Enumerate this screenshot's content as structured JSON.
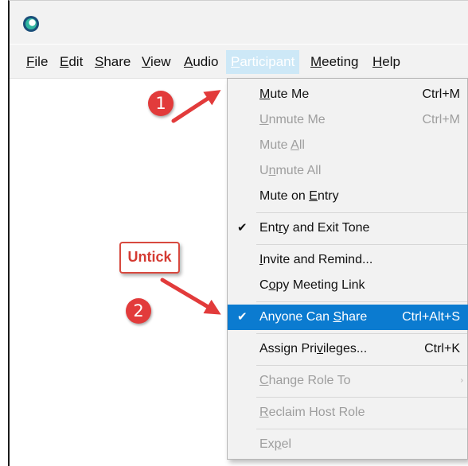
{
  "menubar": {
    "items": [
      {
        "before": "",
        "mnemonic": "F",
        "after": "ile"
      },
      {
        "before": "",
        "mnemonic": "E",
        "after": "dit"
      },
      {
        "before": "",
        "mnemonic": "S",
        "after": "hare"
      },
      {
        "before": "",
        "mnemonic": "V",
        "after": "iew"
      },
      {
        "before": "",
        "mnemonic": "A",
        "after": "udio"
      },
      {
        "before": "",
        "mnemonic": "P",
        "after": "articipant"
      },
      {
        "before": "",
        "mnemonic": "M",
        "after": "eeting"
      },
      {
        "before": "",
        "mnemonic": "H",
        "after": "elp"
      }
    ]
  },
  "dropdown": {
    "items": [
      {
        "before": "",
        "mnemonic": "M",
        "after": "ute Me",
        "shortcut": "Ctrl+M"
      },
      {
        "before": "",
        "mnemonic": "U",
        "after": "nmute Me",
        "shortcut": "Ctrl+M"
      },
      {
        "before": "Mute ",
        "mnemonic": "A",
        "after": "ll",
        "shortcut": ""
      },
      {
        "before": "U",
        "mnemonic": "n",
        "after": "mute All",
        "shortcut": ""
      },
      {
        "before": "Mute on ",
        "mnemonic": "E",
        "after": "ntry",
        "shortcut": ""
      },
      {
        "before": "Ent",
        "mnemonic": "r",
        "after": "y and Exit Tone",
        "shortcut": ""
      },
      {
        "before": "",
        "mnemonic": "I",
        "after": "nvite and Remind...",
        "shortcut": ""
      },
      {
        "before": "C",
        "mnemonic": "o",
        "after": "py Meeting Link",
        "shortcut": ""
      },
      {
        "before": "Anyone Can ",
        "mnemonic": "S",
        "after": "hare",
        "shortcut": "Ctrl+Alt+S"
      },
      {
        "before": "Assign Pri",
        "mnemonic": "v",
        "after": "ileges...",
        "shortcut": "Ctrl+K"
      },
      {
        "before": "",
        "mnemonic": "C",
        "after": "hange Role To",
        "shortcut": ""
      },
      {
        "before": "",
        "mnemonic": "R",
        "after": "eclaim Host Role",
        "shortcut": ""
      },
      {
        "before": "Ex",
        "mnemonic": "p",
        "after": "el",
        "shortcut": ""
      }
    ],
    "check_glyph": "✔",
    "submenu_glyph": "›"
  },
  "annotations": {
    "step1": "1",
    "step2": "2",
    "untick_label": "Untick"
  },
  "colors": {
    "highlight": "#0b7bd0",
    "annotation_red": "#e23b3b"
  }
}
